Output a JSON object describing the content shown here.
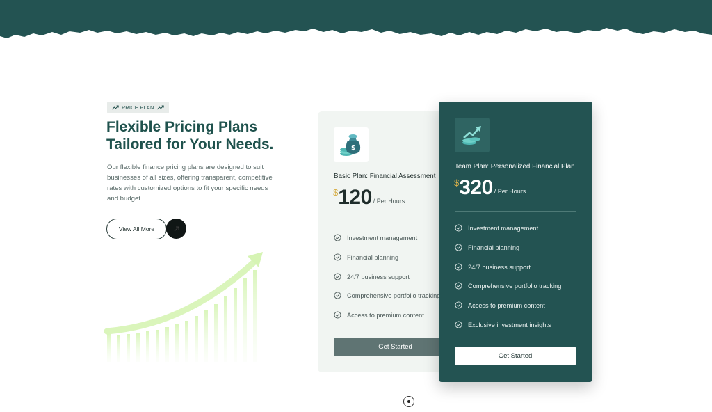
{
  "colors": {
    "brand": "#235352",
    "accent_gold": "#d8b04a",
    "growth_green": "#d8f5b8"
  },
  "section": {
    "badge": "PRICE PLAN",
    "heading_line1": "Flexible Pricing Plans",
    "heading_line2": "Tailored for Your Needs.",
    "intro": "Our flexible finance pricing plans are designed to suit businesses of all sizes, offering transparent, competitive rates with customized options to fit your specific needs and budget.",
    "view_all_label": "View All More",
    "arrow_icon": "arrow-up-right-icon"
  },
  "plans": [
    {
      "icon": "money-bag-icon",
      "name": "Basic Plan: Financial Assessment",
      "currency": "$",
      "price": "120",
      "period": "/ Per Hours",
      "features": [
        "Investment management",
        "Financial planning",
        "24/7 business support",
        "Comprehensive portfolio tracking",
        "Access to premium content"
      ],
      "cta": "Get Started"
    },
    {
      "icon": "growth-chart-icon",
      "name": "Team Plan: Personalized Financial Plan",
      "currency": "$",
      "price": "320",
      "period": "/ Per Hours",
      "features": [
        "Investment management",
        "Financial planning",
        "24/7 business support",
        "Comprehensive portfolio tracking",
        "Access to premium content",
        "Exclusive investment insights"
      ],
      "cta": "Get Started"
    }
  ]
}
